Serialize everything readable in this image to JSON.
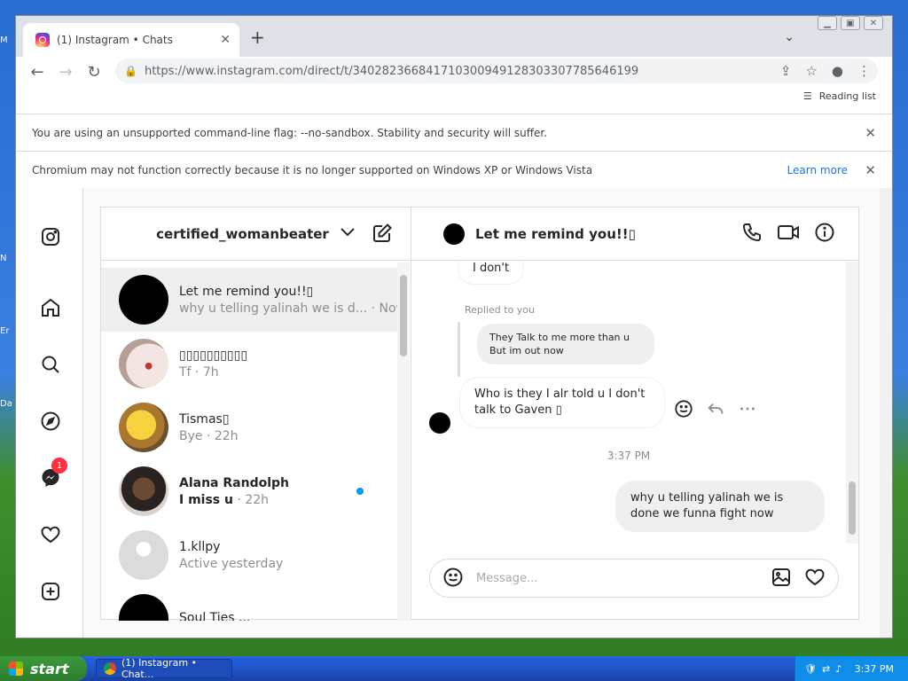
{
  "desktop": {
    "icon_labels": [
      "M",
      "N",
      "Er",
      "Da"
    ]
  },
  "browser": {
    "tab_title": "(1) Instagram • Chats",
    "url": "https://www.instagram.com/direct/t/340282366841710300949128303307785646199",
    "reading_list": "Reading list",
    "infobars": [
      {
        "text": "You are using an unsupported command-line flag: --no-sandbox. Stability and security will suffer."
      },
      {
        "text": "Chromium may not function correctly because it is no longer supported on Windows XP or Windows Vista",
        "link": "Learn more"
      }
    ]
  },
  "inbox": {
    "username": "certified_womanbeater",
    "threads": [
      {
        "name": "Let me remind you!!▯",
        "preview": "why u telling yalinah we is d... · Now",
        "active": true,
        "avatar": "#000000"
      },
      {
        "name": "▯▯▯▯▯▯▯▯▯▯",
        "preview": "Tf · 7h",
        "avatar": "#e8d6d0"
      },
      {
        "name": "Tismas▯",
        "preview": "Bye · 22h",
        "avatar": "#e8c84a"
      },
      {
        "name": "Alana Randolph",
        "preview": "I miss u",
        "preview_time": " · 22h",
        "unread": true,
        "avatar": "#5a4636"
      },
      {
        "name": "1.kllpy",
        "preview": "Active yesterday",
        "avatar": "#dbdbdb"
      },
      {
        "name": "Soul Ties ...",
        "preview": "",
        "avatar": "#000000"
      }
    ]
  },
  "thread": {
    "title": "Let me remind you!!▯",
    "messages": {
      "first": "I don't",
      "replied_label": "Replied to you",
      "quoted": "They Talk to me more than u But im out now",
      "reply": "Who is they I alr told u I don't talk to Gaven ▯",
      "timestamp": "3:37 PM",
      "mine": "why u telling yalinah we is done we funna fight now"
    },
    "composer_placeholder": "Message..."
  },
  "nav": {
    "notification_count": "1"
  },
  "taskbar": {
    "start": "start",
    "task": "(1) Instagram • Chat...",
    "clock": "3:37 PM"
  }
}
